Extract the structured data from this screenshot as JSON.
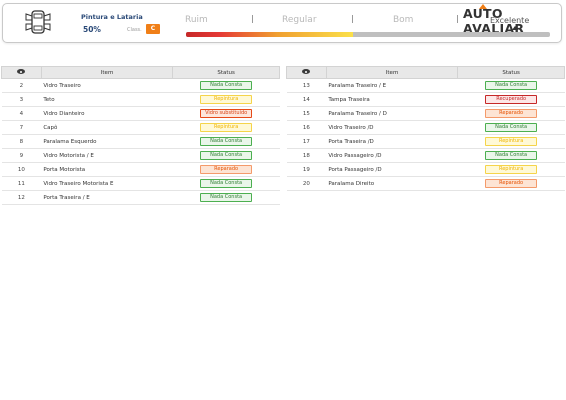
{
  "header": {
    "section_title": "Pintura e Lataria",
    "percent": "50%",
    "class_label": "Class.",
    "class_value": "C",
    "scale": [
      "Ruim",
      "Regular",
      "Bom",
      "Excelente"
    ],
    "logo": "AUTO AVALIAR",
    "progress_fraction": 0.46,
    "icon": "car-body-icon"
  },
  "columns": {
    "eye_icon": "eye-icon",
    "item": "Item",
    "status": "Status"
  },
  "status_styles": {
    "Nada Consta": {
      "color": "#2e7d32",
      "bg": "#eaf6ea",
      "border": "#4caf50"
    },
    "Repintura": {
      "color": "#f0b400",
      "bg": "#fff9d6",
      "border": "#f5d44a"
    },
    "Vidro substituído": {
      "color": "#d84315",
      "bg": "#fde6dc",
      "border": "#e64a19"
    },
    "Reparado": {
      "color": "#e65100",
      "bg": "#fde4d4",
      "border": "#f49a6a"
    },
    "Recuperado": {
      "color": "#c62828",
      "bg": "#fde7e7",
      "border": "#c62828"
    }
  },
  "left_rows": [
    {
      "num": "2",
      "item": "Vidro Traseiro",
      "status": "Nada Consta"
    },
    {
      "num": "3",
      "item": "Teto",
      "status": "Repintura"
    },
    {
      "num": "4",
      "item": "Vidro Dianteiro",
      "status": "Vidro substituído"
    },
    {
      "num": "7",
      "item": "Capô",
      "status": "Repintura"
    },
    {
      "num": "8",
      "item": "Paralama Esquerdo",
      "status": "Nada Consta"
    },
    {
      "num": "9",
      "item": "Vidro Motorista / E",
      "status": "Nada Consta"
    },
    {
      "num": "10",
      "item": "Porta Motorista",
      "status": "Reparado"
    },
    {
      "num": "11",
      "item": "Vidro Traseiro Motorista E",
      "status": "Nada Consta"
    },
    {
      "num": "12",
      "item": "Porta Traseira / E",
      "status": "Nada Consta"
    }
  ],
  "right_rows": [
    {
      "num": "13",
      "item": "Paralama Traseiro / E",
      "status": "Nada Consta"
    },
    {
      "num": "14",
      "item": "Tampa Traseira",
      "status": "Recuperado"
    },
    {
      "num": "15",
      "item": "Paralama Traseiro / D",
      "status": "Reparado"
    },
    {
      "num": "16",
      "item": "Vidro Traseiro /D",
      "status": "Nada Consta"
    },
    {
      "num": "17",
      "item": "Porta Traseira /D",
      "status": "Repintura"
    },
    {
      "num": "18",
      "item": "Vidro Passageiro /D",
      "status": "Nada Consta"
    },
    {
      "num": "19",
      "item": "Porta Passageiro /D",
      "status": "Repintura"
    },
    {
      "num": "20",
      "item": "Paralama Direito",
      "status": "Reparado"
    }
  ]
}
